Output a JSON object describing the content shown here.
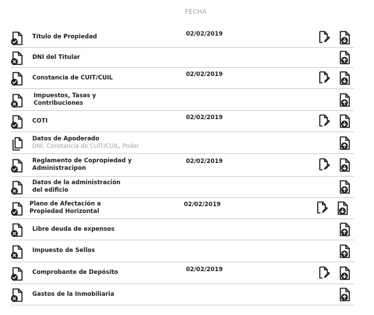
{
  "header": {
    "date_column": "FECHA"
  },
  "rows": [
    {
      "name": "Título de Propiedad",
      "date": "02/02/2019",
      "status": "check",
      "action": "download",
      "editable": true
    },
    {
      "name": "DNI del Titular",
      "date": "",
      "status": "cross",
      "action": "upload",
      "editable": false
    },
    {
      "name": "Constancia de CUIT/CUIL",
      "date": "02/02/2019",
      "status": "check",
      "action": "download",
      "editable": true
    },
    {
      "name": "Impuestos, Tasas y\nContribuciones",
      "date": "",
      "status": "cross",
      "action": "upload",
      "editable": false
    },
    {
      "name": "COTI",
      "date": "02/02/2019",
      "status": "check",
      "action": "download",
      "editable": true
    },
    {
      "name": "Datos de Apoderado",
      "subtitle": "DNI, Constancia de CUIT/CUIL, Poder",
      "date": "",
      "status": "multi",
      "action": "upload",
      "editable": false
    },
    {
      "name": "Reglamento de Copropiedad y\nAdministracipon",
      "date": "02/02/2019",
      "status": "check",
      "action": "download",
      "editable": true
    },
    {
      "name": "Datos de la administración\ndel edificio",
      "date": "",
      "status": "cross",
      "action": "upload",
      "editable": false
    },
    {
      "name": "Plano de Afectación a\nPropiedad Horizontal",
      "date": "02/02/2019",
      "status": "check",
      "action": "download",
      "editable": true
    },
    {
      "name": "Libre deuda de expensos",
      "date": "",
      "status": "cross",
      "action": "upload",
      "editable": false
    },
    {
      "name": "Impuesto de Sellos",
      "date": "",
      "status": "cross",
      "action": "upload",
      "editable": false
    },
    {
      "name": "Comprobante de Depósito",
      "date": "02/02/2019",
      "status": "check",
      "action": "download",
      "editable": true
    },
    {
      "name": "Gastos de la Inmobiliaria",
      "date": "",
      "status": "cross",
      "action": "upload",
      "editable": false
    }
  ],
  "icons": {
    "check": "document-check-icon",
    "cross": "document-cross-icon",
    "multi": "documents-stack-icon",
    "edit": "edit-document-icon",
    "download": "download-document-icon",
    "upload": "upload-document-icon"
  },
  "colors": {
    "text": "#1e1e1e",
    "muted": "#a0a0a0",
    "divider": "#cfcfcf"
  }
}
